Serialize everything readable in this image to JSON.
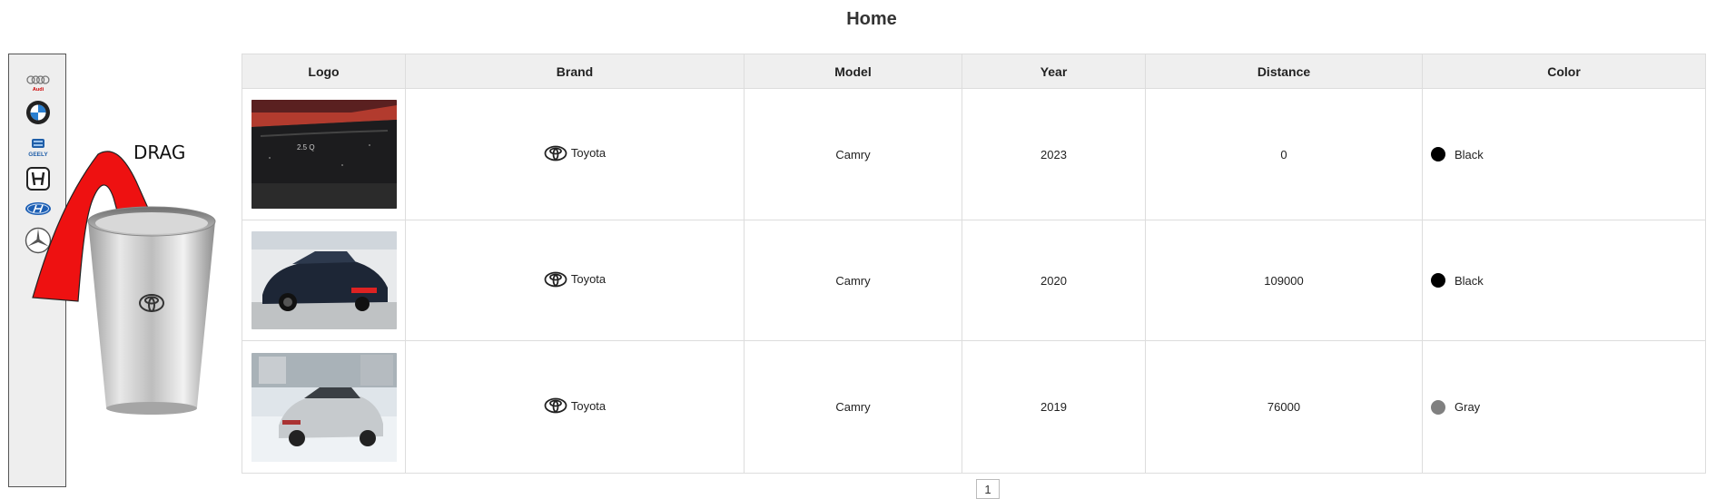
{
  "page": {
    "title": "Home"
  },
  "sidebar": {
    "items": [
      {
        "brand": "Audi",
        "icon": "audi-logo-icon",
        "text": "Audi"
      },
      {
        "brand": "BMW",
        "icon": "bmw-logo-icon"
      },
      {
        "brand": "Geely",
        "icon": "geely-logo-icon",
        "text": "GEELY"
      },
      {
        "brand": "Honda",
        "icon": "honda-logo-icon"
      },
      {
        "brand": "Hyundai",
        "icon": "hyundai-logo-icon"
      },
      {
        "brand": "Mercedes-Benz",
        "icon": "mercedes-logo-icon"
      }
    ]
  },
  "drag_hint": {
    "label": "DRAG",
    "icon": "curved-arrow-icon",
    "cup_icon": "steel-cup-toyota-icon",
    "arrow_color": "#ff0000"
  },
  "table": {
    "headers": [
      "Logo",
      "Brand",
      "Model",
      "Year",
      "Distance",
      "Color"
    ],
    "rows": [
      {
        "photo": "black-camry-rear-photo",
        "brand": "Toyota",
        "model": "Camry",
        "year": "2023",
        "distance": "0",
        "color": "Black",
        "color_hex": "#000000"
      },
      {
        "photo": "dark-blue-camry-front-photo",
        "brand": "Toyota",
        "model": "Camry",
        "year": "2020",
        "distance": "109000",
        "color": "Black",
        "color_hex": "#000000"
      },
      {
        "photo": "silver-camry-snow-photo",
        "brand": "Toyota",
        "model": "Camry",
        "year": "2019",
        "distance": "76000",
        "color": "Gray",
        "color_hex": "#808080"
      }
    ]
  },
  "pagination": {
    "current": "1"
  }
}
